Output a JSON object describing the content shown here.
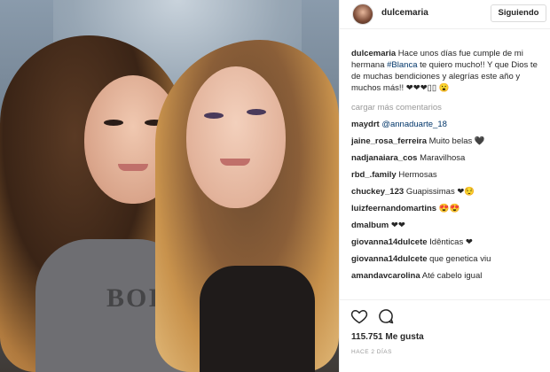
{
  "post": {
    "username": "dulcemaria",
    "follow_label": "Siguiendo",
    "caption_user": "dulcemaria",
    "caption_text_1": " Hace unos días fue cumple de mi hermana ",
    "caption_tag": "#Blanca",
    "caption_text_2": " te quiero mucho!! Y que Dios te de muchas bendiciones y alegrías este año y muchos más!! ❤❤❤▯▯ 😮",
    "load_more": "cargar más comentarios",
    "likes": "115.751 Me gusta",
    "time": "HACE 2 DÍAS",
    "photo_shirt_text": "BOI"
  },
  "comments": [
    {
      "user": "maydrt",
      "text": "@annaduarte_18",
      "mention": true
    },
    {
      "user": "jaine_rosa_ferreira",
      "text": "Muito belas 🖤"
    },
    {
      "user": "nadjanaiara_cos",
      "text": "Maravilhosa"
    },
    {
      "user": "rbd_.family",
      "text": "Hermosas"
    },
    {
      "user": "chuckey_123",
      "text": "Guapissimas ❤😌"
    },
    {
      "user": "luizfeernandomartins",
      "text": "😍😍"
    },
    {
      "user": "dmalbum",
      "text": "❤❤"
    },
    {
      "user": "giovanna14dulcete",
      "text": "Idênticas ❤"
    },
    {
      "user": "giovanna14dulcete",
      "text": "que genetica viu"
    },
    {
      "user": "amandavcarolina",
      "text": "Até cabelo igual"
    }
  ],
  "icons": [
    "heart-icon",
    "comment-icon"
  ],
  "colors": {
    "link": "#003569",
    "muted": "#999999",
    "text": "#262626"
  }
}
